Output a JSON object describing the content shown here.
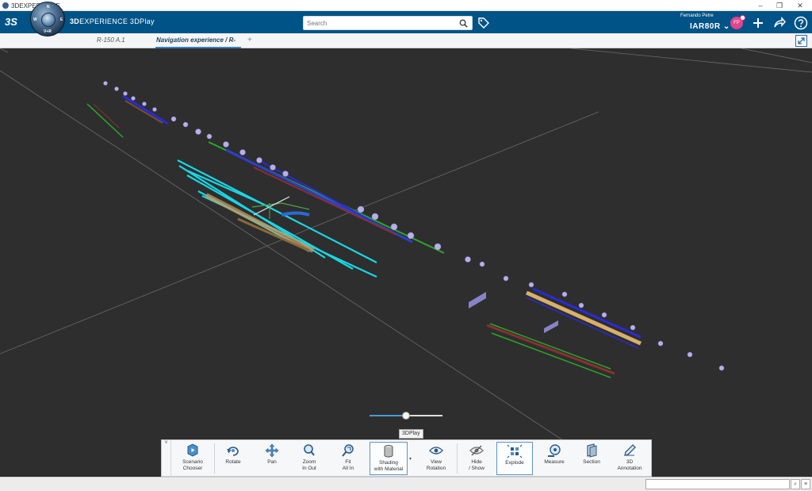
{
  "os": {
    "title": "3DEXPERIENCE",
    "minimize": "–",
    "restore": "❐",
    "close": "✕"
  },
  "header": {
    "brand": "3S",
    "app_name_bold": "3D",
    "app_name_rest": "EXPERIENCE 3DPlay",
    "compass_marks": {
      "n": "N",
      "w": "W",
      "e": "E",
      "s": "V+R"
    },
    "search_placeholder": "Search",
    "user_name": "Fernando Petre",
    "tenant": "IAR80R",
    "avatar_initials": "FP"
  },
  "tabs": [
    {
      "label": "R-150 A.1"
    },
    {
      "label": "Navigation experience / R-"
    }
  ],
  "tab_add": "+",
  "tooltip": "3DPlay",
  "toolbar": {
    "collapse": "˅",
    "tools": [
      {
        "label": "Scenario\nChooser",
        "icon": "scenario-chooser-icon"
      },
      {
        "label": "Rotate",
        "icon": "rotate-icon"
      },
      {
        "label": "Pan",
        "icon": "pan-icon"
      },
      {
        "label": "Zoom\nIn Out",
        "icon": "zoom-icon"
      },
      {
        "label": "Fit\nAll In",
        "icon": "fit-all-icon"
      },
      {
        "label": "Shading\nwith Material",
        "icon": "shading-icon"
      },
      {
        "label": "View\nRotation",
        "icon": "view-rotation-icon"
      },
      {
        "label": "Hide\n/ Show",
        "icon": "hide-show-icon"
      },
      {
        "label": "Explode",
        "icon": "explode-icon"
      },
      {
        "label": "Measure",
        "icon": "measure-icon"
      },
      {
        "label": "Section",
        "icon": "section-icon"
      },
      {
        "label": "3D\nAnnotation",
        "icon": "annotation-icon"
      }
    ]
  },
  "slider": {
    "value": 0.5
  },
  "colors": {
    "header": "#005386",
    "accent": "#3d7fc1",
    "viewport": "#2e2e2e"
  }
}
